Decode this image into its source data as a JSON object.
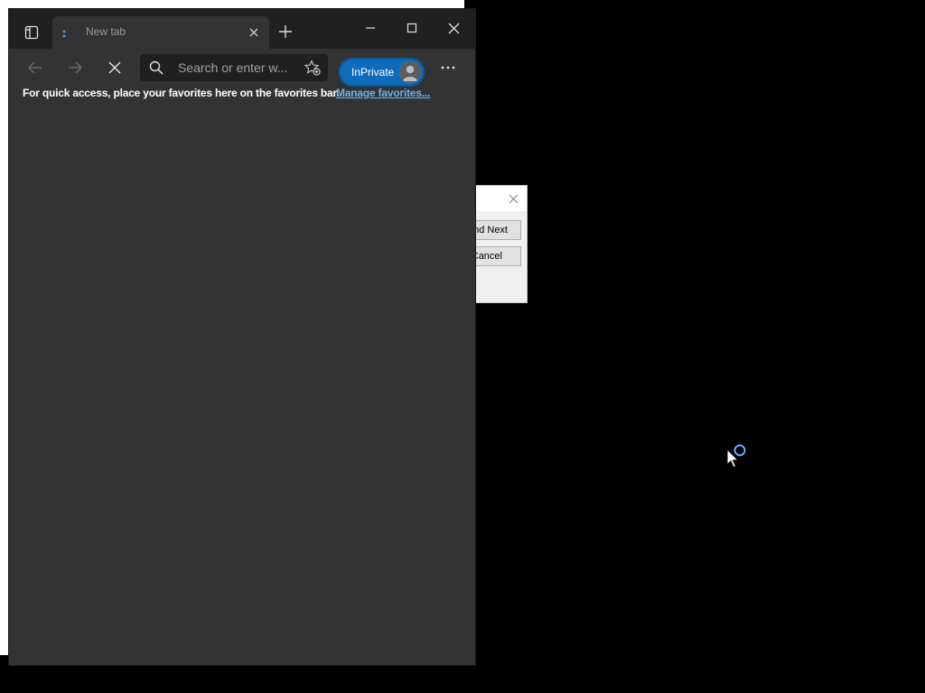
{
  "browser": {
    "tab": {
      "title": "New tab"
    },
    "toolbar": {
      "address_placeholder": "Search or enter w...",
      "inprivate_label": "InPrivate"
    },
    "favorites_bar": {
      "message": "For quick access, place your favorites here on the favorites bar.",
      "link": "Manage favorites..."
    }
  },
  "dialog": {
    "find_next_label": "nd Next",
    "cancel_label": "Cancel"
  },
  "colors": {
    "accent": "#0f6cbd",
    "link": "#6cb4f0",
    "chrome_dark": "#202020",
    "chrome": "#333333"
  },
  "icons": {
    "tab_actions": "tab-actions-icon",
    "favicon": "loading-dots-icon",
    "tab_close": "close-icon",
    "new_tab": "plus-icon",
    "minimize": "minimize-icon",
    "maximize": "maximize-icon",
    "close": "close-icon",
    "back": "back-arrow-icon",
    "forward": "forward-arrow-icon",
    "stop": "stop-icon",
    "search": "search-icon",
    "add_favorite": "add-favorite-icon",
    "more": "more-icon",
    "cursor": "busy-cursor-icon"
  }
}
